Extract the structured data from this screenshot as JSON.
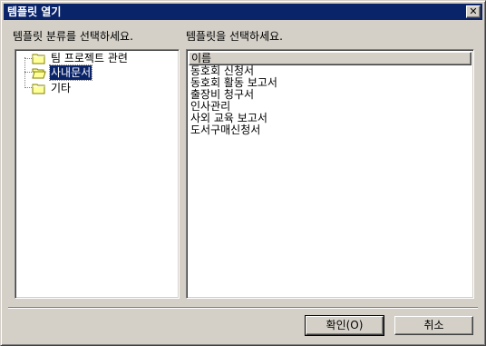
{
  "window": {
    "title": "템플릿 열기",
    "close_glyph": "✕"
  },
  "left_panel": {
    "label": "템플릿 분류를 선택하세요.",
    "tree": [
      {
        "label": "팀 프로젝트 관련",
        "icon": "folder-closed-icon",
        "selected": false
      },
      {
        "label": "사내문서",
        "icon": "folder-open-icon",
        "selected": true
      },
      {
        "label": "기타",
        "icon": "folder-closed-icon",
        "selected": false
      }
    ]
  },
  "right_panel": {
    "label": "템플릿을 선택하세요.",
    "column_header": "이름",
    "items": [
      "동호회 신청서",
      "동호회 활동 보고서",
      "출장비 청구서",
      "인사관리",
      "사외 교육 보고서",
      "도서구매신청서"
    ]
  },
  "buttons": {
    "ok": "확인(O)",
    "cancel": "취소"
  },
  "colors": {
    "face": "#d4d0c8",
    "titlebar": "#0a246a",
    "selection": "#0a246a"
  }
}
